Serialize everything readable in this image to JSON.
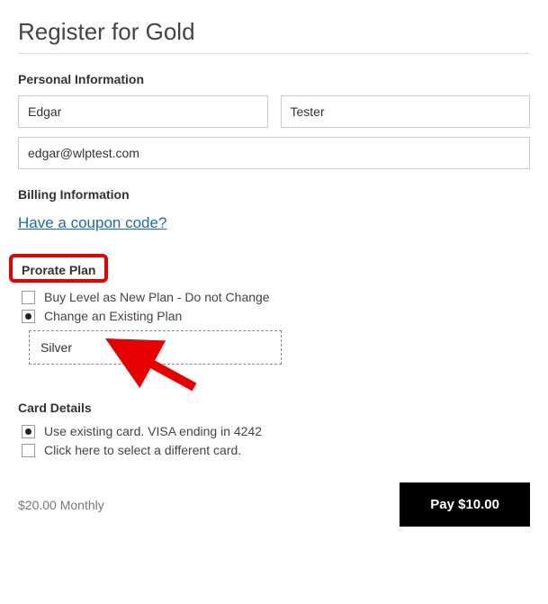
{
  "page_title": "Register for Gold",
  "personal": {
    "heading": "Personal Information",
    "first_name": "Edgar",
    "last_name": "Tester",
    "email": "edgar@wlptest.com"
  },
  "billing": {
    "heading": "Billing Information",
    "coupon_link": "Have a coupon code?"
  },
  "prorate": {
    "heading": "Prorate Plan",
    "option_new": "Buy Level as New Plan - Do not Change",
    "option_change": "Change an Existing Plan",
    "selected_plan": "Silver"
  },
  "card": {
    "heading": "Card Details",
    "option_existing": "Use existing card. VISA ending in 4242",
    "option_different": "Click here to select a different card."
  },
  "footer": {
    "price_text": "$20.00 Monthly",
    "pay_button": "Pay $10.00"
  }
}
